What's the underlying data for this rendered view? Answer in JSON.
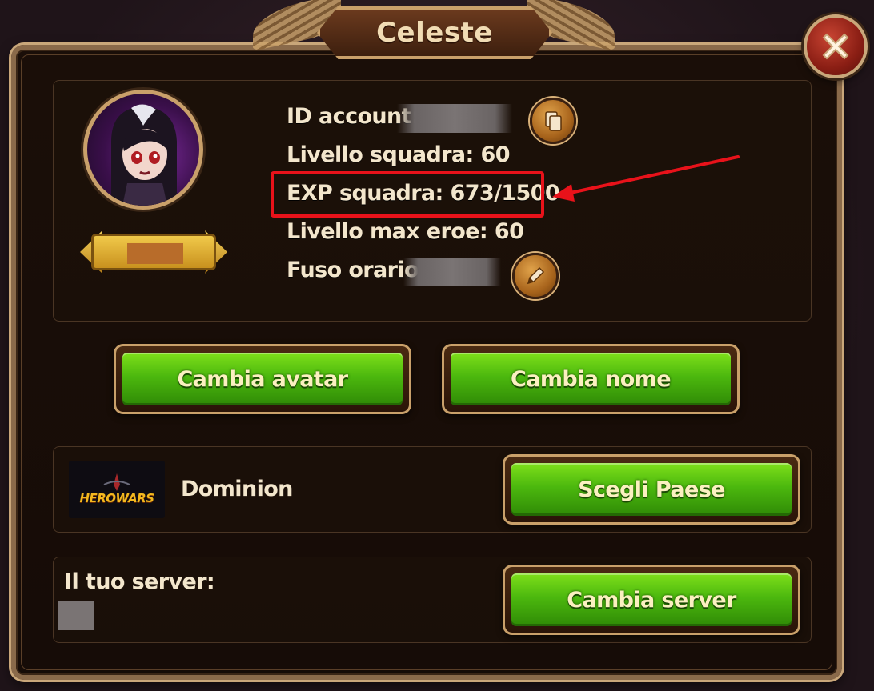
{
  "dialog": {
    "title": "Celeste",
    "close_icon": "close-x-icon"
  },
  "profile": {
    "account_id_label": "ID account:",
    "team_level_label": "Livello squadra: 60",
    "team_exp_label": "EXP squadra: 673/1500",
    "max_hero_level_label": "Livello max eroe: 60",
    "timezone_label": "Fuso orario:",
    "copy_icon": "copy-icon",
    "edit_icon": "pencil-icon"
  },
  "buttons": {
    "change_avatar": "Cambia avatar",
    "change_name": "Cambia nome",
    "choose_country": "Scegli Paese",
    "change_server": "Cambia server"
  },
  "country": {
    "logo_text": "HEROWARS",
    "name": "Dominion"
  },
  "server": {
    "label": "Il tuo server:"
  },
  "colors": {
    "highlight": "#e8121a",
    "button_green": "#4cb80e",
    "frame_gold": "#c9a06a"
  }
}
